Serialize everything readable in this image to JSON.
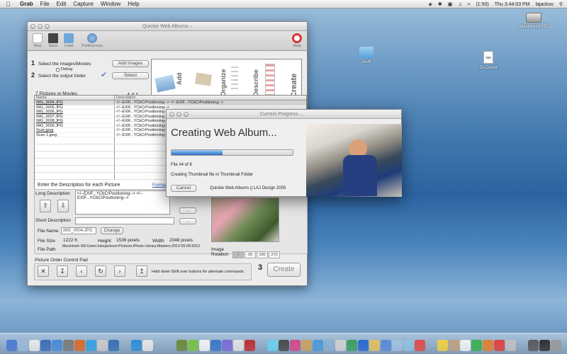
{
  "menubar": {
    "app_name": "Grab",
    "menus": [
      "File",
      "Edit",
      "Capture",
      "Window",
      "Help"
    ],
    "battery": "(1:50)",
    "clock": "Thu 3:44:03 PM",
    "user": "lajackso"
  },
  "desktop": {
    "icons": [
      {
        "label": "Macintosh HD",
        "icon": "hard-drive-icon"
      },
      {
        "label": "stuff",
        "icon": "folder-icon"
      },
      {
        "label": "To Donxt",
        "icon": "text-document-icon",
        "doc_text": "TXT"
      }
    ]
  },
  "main_window": {
    "title": "Quickie Web Albums –",
    "toolbar": {
      "new": "New",
      "save": "Save",
      "load": "Load",
      "preferences": "Preferences",
      "help": "Help"
    },
    "steps": {
      "step1_num": "1",
      "step1_label": "Select the Images\\Movies",
      "debug_label": "Debug",
      "step2_num": "2",
      "step2_label": "Select the output folder",
      "add_images": "Add Images",
      "select": "Select",
      "step3_num": "3"
    },
    "banner": {
      "words": [
        "Add",
        "Organize",
        "Describe",
        "Create"
      ]
    },
    "count_label": "7 Pictures or Movies",
    "version": "4.4.1",
    "table": {
      "headers": [
        "Name",
        "Description"
      ],
      "rows": [
        {
          "name": "IMG_0004.JPG",
          "desc": "<!--EXIF...YCbCrPositioning--> <!--EXIF...YCbCrPositioning-->"
        },
        {
          "name": "IMG_0005.JPG",
          "desc": "<!--EXIF...YCbCrPositioning-->"
        },
        {
          "name": "IMG_0006.JPG",
          "desc": "<!--EXIF...YCbCrPositioning-->"
        },
        {
          "name": "IMG_0007.JPG",
          "desc": "<!--EXIF...YCbCrPositioning-->"
        },
        {
          "name": "IMG_0008.JPG",
          "desc": "<!--EXIF...YCbCrPositioning-->"
        },
        {
          "name": "IMG_0009.JPG",
          "desc": "<!--EXIF...YCbCrPositioning-->"
        },
        {
          "name": "Scan.jpeg",
          "desc": "<!--EXIF...YCbCrPositioning-->"
        },
        {
          "name": "Scan 1.jpeg",
          "desc": "<!--EXIF...YCbCrPositioning-->"
        }
      ]
    },
    "description_heading": "Enter  the Description for each Picture",
    "format_link": "Format",
    "long_description_label": "Long Description",
    "long_description_value": "<!--EXIF...YCbCrPositioning--> <!--EXIF...YCbCrPositioning-->",
    "short_description_label": "Short Description",
    "ellipsis": "...",
    "file_name_label": "File Name",
    "file_name_value": "IMG_0004.JPG",
    "change_label": "Change",
    "file_size_label": "File Size",
    "file_size_value": "1222 K",
    "height_label": "Height",
    "height_value": "1536 pixels",
    "width_label": "Width",
    "width_value": "2048 pixels",
    "file_path_label": "File Path",
    "file_path_value": "Macintosh HD:Users:lukejackson:Pictures:iPhoto Library:Masters:2012:05:09:2012",
    "image_rotation_label": "Image Rotation",
    "rotations": [
      "0",
      "90",
      "180",
      "270"
    ],
    "control_pad_label": "Picture Order Control Pad",
    "shift_hint": "Hold down Shift over buttons for alternate commands",
    "create_label": "Create"
  },
  "progress_window": {
    "title": "Current Progress ...",
    "heading": "Creating Web Album...",
    "progress_fraction": 0.42,
    "file_status": "File #4 of 8",
    "step_status": "Creating Thumbnail file in Thumbnail Folder",
    "cancel_label": "Cancel",
    "credit": "Quickie Web Albums || LAJ Design 2005"
  },
  "colors": {
    "progress_fill": "#4f8fd6",
    "banner_text": "#666666",
    "checkmark": "#6a7fd8"
  }
}
